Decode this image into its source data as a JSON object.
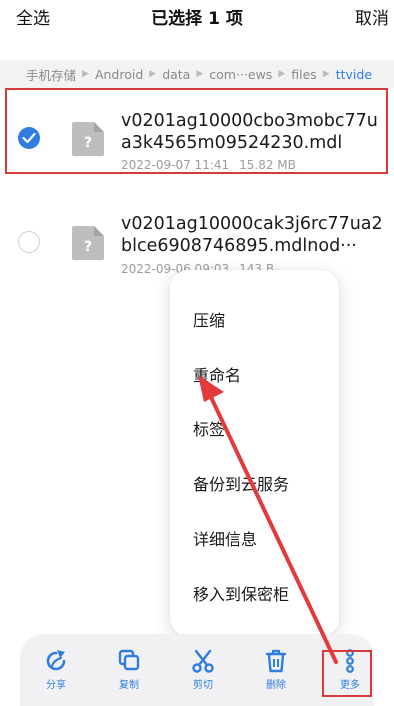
{
  "topbar": {
    "select_all": "全选",
    "title": "已选择 1 项",
    "cancel": "取消"
  },
  "breadcrumb": [
    "手机存储",
    "Android",
    "data",
    "com···ews",
    "files",
    "ttvide"
  ],
  "files": [
    {
      "name": "v0201ag10000cbo3mobc77ua3k4565m09524230.mdl",
      "date": "2022-09-07 11:41",
      "size": "15.82 MB",
      "selected": true
    },
    {
      "name": "v0201ag10000cak3j6rc77ua2blce6908746895.mdlnod···",
      "date": "2022-09-06 09:03",
      "size": "143 B",
      "selected": false
    }
  ],
  "menu": [
    "压缩",
    "重命名",
    "标签",
    "备份到云服务",
    "详细信息",
    "移入到保密柜"
  ],
  "toolbar": {
    "share": "分享",
    "copy": "复制",
    "cut": "剪切",
    "delete": "删除",
    "more": "更多"
  },
  "colors": {
    "accent": "#2f7de1",
    "annotation": "#d63a3a"
  }
}
